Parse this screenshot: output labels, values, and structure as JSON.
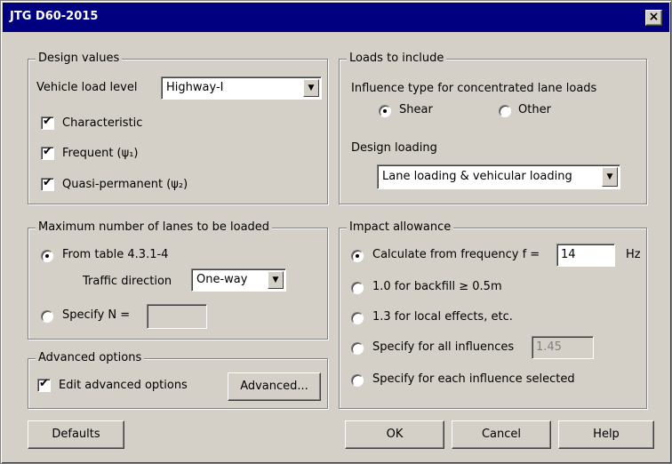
{
  "window": {
    "title": "JTG D60-2015",
    "close_label": "×"
  },
  "design_values": {
    "legend": "Design values",
    "vehicle_load_label": "Vehicle load level",
    "vehicle_load_value": "Highway-I",
    "characteristic_label": "Characteristic",
    "frequent_label": "Frequent (ψ₁)",
    "quasi_label": "Quasi-permanent (ψ₂)"
  },
  "lanes": {
    "legend": "Maximum number of lanes to be loaded",
    "from_table_label": "From table 4.3.1-4",
    "traffic_direction_label": "Traffic direction",
    "traffic_direction_value": "One-way",
    "specify_n_label": "Specify N =",
    "specify_n_value": ""
  },
  "advanced": {
    "legend": "Advanced options",
    "edit_label": "Edit advanced options",
    "button_label": "Advanced..."
  },
  "loads": {
    "legend": "Loads to include",
    "influence_label": "Influence type for concentrated lane loads",
    "shear_label": "Shear",
    "other_label": "Other",
    "design_loading_label": "Design loading",
    "design_loading_value": "Lane loading & vehicular loading"
  },
  "impact": {
    "legend": "Impact allowance",
    "calc_label": "Calculate from frequency f =",
    "calc_value": "14",
    "calc_unit": "Hz",
    "backfill_label": "1.0 for backfill ≥ 0.5m",
    "local_label": "1.3 for local effects, etc.",
    "all_label": "Specify for all influences",
    "all_value": "1.45",
    "each_label": "Specify for each influence selected"
  },
  "buttons": {
    "defaults": "Defaults",
    "ok": "OK",
    "cancel": "Cancel",
    "help": "Help"
  }
}
